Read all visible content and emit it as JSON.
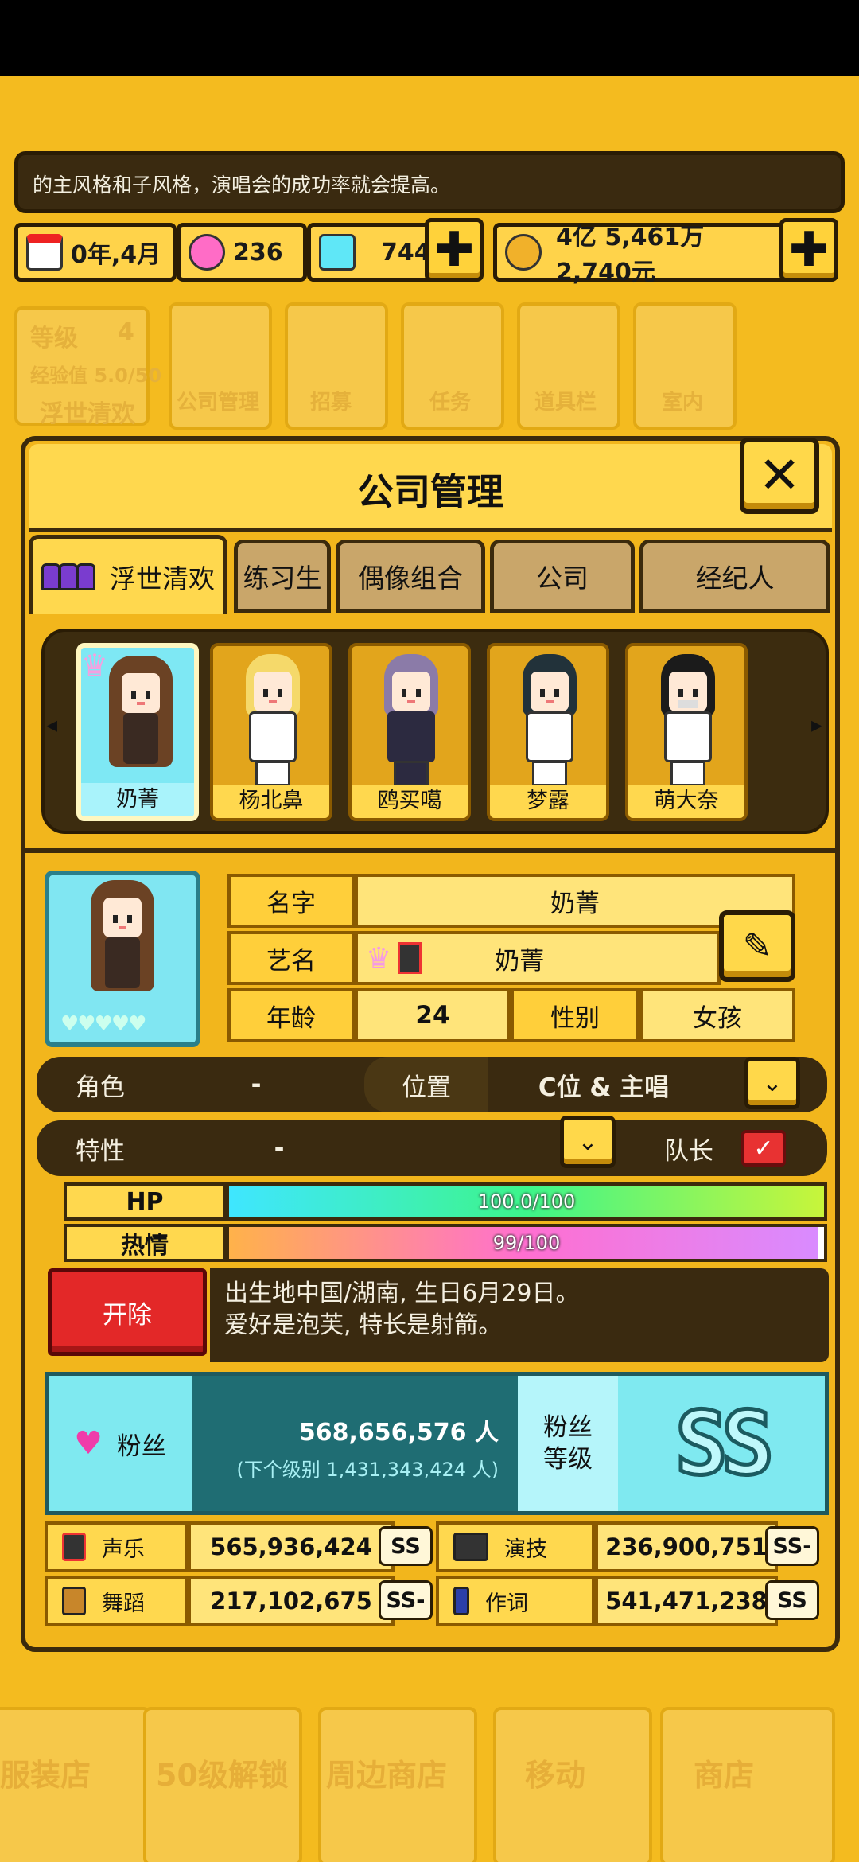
{
  "message": "的主风格和子风格，演唱会的成功率就会提高。",
  "resources": {
    "date": "0年,4月",
    "pink_gems": "236",
    "blue_gems": "744",
    "money": "4亿 5,461万 2,740元",
    "plus_symbol": "✚"
  },
  "background": {
    "level_label": "等级",
    "level_value": "4",
    "exp": "经验值 5.0/50",
    "group_name": "浮世清欢",
    "menu": [
      "公司管理",
      "招募",
      "任务",
      "道具栏",
      "室内"
    ],
    "bottom_nav": [
      "服装店",
      "50级解锁",
      "周边商店",
      "移动",
      "商店"
    ]
  },
  "dialog": {
    "title": "公司管理",
    "close_symbol": "✕",
    "tabs": [
      "浮世清欢",
      "练习生",
      "偶像组合",
      "公司",
      "经纪人"
    ]
  },
  "roster": {
    "left_arrow": "◂",
    "right_arrow": "▸",
    "characters": [
      {
        "name": "奶菁"
      },
      {
        "name": "杨北鼻"
      },
      {
        "name": "鸥买噶"
      },
      {
        "name": "梦露"
      },
      {
        "name": "萌大奈"
      }
    ]
  },
  "profile": {
    "name_label": "名字",
    "name_value": "奶菁",
    "stage_label": "艺名",
    "stage_value": "奶菁",
    "age_label": "年龄",
    "age_value": "24",
    "gender_label": "性别",
    "gender_value": "女孩",
    "role_label": "角色",
    "role_value": "-",
    "position_label": "位置",
    "position_value": "C位 & 主唱",
    "trait_label": "特性",
    "trait_value": "-",
    "leader_label": "队长",
    "edit_symbol": "✎",
    "dropdown_symbol": "⌄",
    "check_symbol": "✓",
    "hearts": "♥♥♥♥♥"
  },
  "stats": {
    "hp_label": "HP",
    "hp_text": "100.0/100",
    "hp_fraction": 1.0,
    "passion_label": "热情",
    "passion_text": "99/100",
    "passion_fraction": 0.99
  },
  "fire_button": "开除",
  "bio": {
    "line1": "出生地中国/湖南, 生日6月29日。",
    "line2": "爱好是泡芙, 特长是射箭。"
  },
  "fans": {
    "label": "粉丝",
    "count": "568,656,576 人",
    "next_level": "(下个级别 1,431,343,424 人)",
    "level_label_1": "粉丝",
    "level_label_2": "等级",
    "grade": "SS"
  },
  "skills": [
    {
      "name": "声乐",
      "value": "565,936,424",
      "grade": "SS"
    },
    {
      "name": "演技",
      "value": "236,900,751",
      "grade": "SS-"
    },
    {
      "name": "舞蹈",
      "value": "217,102,675",
      "grade": "SS-"
    },
    {
      "name": "作词",
      "value": "541,471,238",
      "grade": "SS"
    }
  ],
  "colors": {
    "hp_gradient": [
      "#3fe6ff",
      "#3df58a",
      "#c8f53a"
    ],
    "passion_gradient": [
      "#ffb24a",
      "#ff6fd0",
      "#d98bff"
    ],
    "accent": "#ffd84e",
    "dark": "#3a2a10"
  }
}
